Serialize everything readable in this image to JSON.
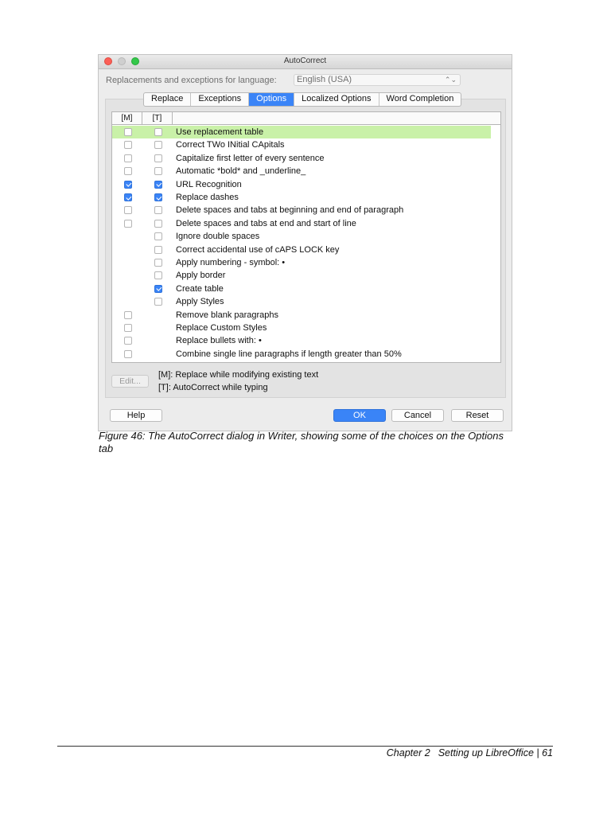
{
  "dialog": {
    "title": "AutoCorrect",
    "language_label": "Replacements and exceptions for language:",
    "language_value": "English (USA)",
    "tabs": [
      {
        "label": "Replace",
        "active": false
      },
      {
        "label": "Exceptions",
        "active": false
      },
      {
        "label": "Options",
        "active": true
      },
      {
        "label": "Localized Options",
        "active": false
      },
      {
        "label": "Word Completion",
        "active": false
      }
    ],
    "list_header": {
      "m": "[M]",
      "t": "[T]"
    },
    "options": [
      {
        "label": "Use replacement table",
        "m": false,
        "t": false,
        "highlight": true,
        "has_m": true,
        "has_t": true
      },
      {
        "label": "Correct TWo INitial CApitals",
        "m": false,
        "t": false,
        "has_m": true,
        "has_t": true
      },
      {
        "label": "Capitalize first letter of every sentence",
        "m": false,
        "t": false,
        "has_m": true,
        "has_t": true
      },
      {
        "label": "Automatic *bold* and _underline_",
        "m": false,
        "t": false,
        "has_m": true,
        "has_t": true
      },
      {
        "label": "URL Recognition",
        "m": true,
        "t": true,
        "has_m": true,
        "has_t": true
      },
      {
        "label": "Replace dashes",
        "m": true,
        "t": true,
        "has_m": true,
        "has_t": true
      },
      {
        "label": "Delete spaces and tabs at beginning and end of paragraph",
        "m": false,
        "t": false,
        "has_m": true,
        "has_t": true
      },
      {
        "label": "Delete spaces and tabs at end and start of line",
        "m": false,
        "t": false,
        "has_m": true,
        "has_t": true
      },
      {
        "label": "Ignore double spaces",
        "m": false,
        "t": false,
        "has_m": false,
        "has_t": true
      },
      {
        "label": "Correct accidental use of cAPS LOCK key",
        "m": false,
        "t": false,
        "has_m": false,
        "has_t": true
      },
      {
        "label": "Apply numbering - symbol: •",
        "m": false,
        "t": false,
        "has_m": false,
        "has_t": true
      },
      {
        "label": "Apply border",
        "m": false,
        "t": false,
        "has_m": false,
        "has_t": true
      },
      {
        "label": "Create table",
        "m": false,
        "t": true,
        "has_m": false,
        "has_t": true
      },
      {
        "label": "Apply Styles",
        "m": false,
        "t": false,
        "has_m": false,
        "has_t": true
      },
      {
        "label": "Remove blank paragraphs",
        "m": false,
        "t": false,
        "has_m": true,
        "has_t": false
      },
      {
        "label": "Replace Custom Styles",
        "m": false,
        "t": false,
        "has_m": true,
        "has_t": false
      },
      {
        "label": "Replace bullets with: •",
        "m": false,
        "t": false,
        "has_m": true,
        "has_t": false
      },
      {
        "label": "Combine single line paragraphs if length greater than 50%",
        "m": false,
        "t": false,
        "has_m": true,
        "has_t": false
      }
    ],
    "edit_label": "Edit...",
    "legend_m": "[M]: Replace while modifying existing text",
    "legend_t": "[T]: AutoCorrect while typing",
    "buttons": {
      "help": "Help",
      "ok": "OK",
      "cancel": "Cancel",
      "reset": "Reset"
    }
  },
  "caption": "Figure 46: The AutoCorrect dialog in Writer, showing some of the choices on the Options tab",
  "footer": {
    "chapter": "Chapter 2",
    "title": "Setting up LibreOffice | 61"
  },
  "colors": {
    "accent": "#3a84f7",
    "highlight": "#c9f1a8"
  }
}
